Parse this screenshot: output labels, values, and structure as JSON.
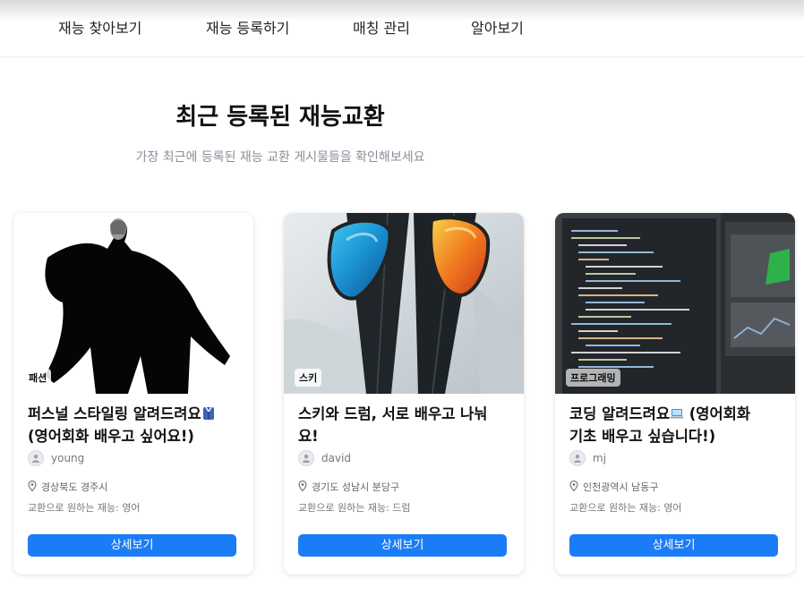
{
  "nav": {
    "items": [
      {
        "label": "재능 찾아보기"
      },
      {
        "label": "재능 등록하기"
      },
      {
        "label": "매칭 관리"
      },
      {
        "label": "알아보기"
      }
    ]
  },
  "section": {
    "title": "최근 등록된 재능교환",
    "subtitle": "가장 최근에 등록된 재능 교환 게시물들을 확인해보세요"
  },
  "cards": [
    {
      "category": "패션",
      "title_line1": "퍼스널 스타일링 알려드려요",
      "title_line2": "(영어회화 배우고 싶어요!)",
      "title_emoji": "dress-emoji",
      "username": "young",
      "location": "경상북도 경주시",
      "wanted": "교환으로 원하는 재능: 영어",
      "button_label": "상세보기"
    },
    {
      "category": "스키",
      "title_line1": "스키와 드럼, 서로 배우고 나눠",
      "title_line2": "요!",
      "username": "david",
      "location": "경기도 성남시 분당구",
      "wanted": "교환으로 원하는 재능: 드럼",
      "button_label": "상세보기"
    },
    {
      "category": "프로그래밍",
      "title_line1": "코딩 알려드려요",
      "title_line1b": " (영어회화",
      "title_line2": "기초 배우고 싶습니다!)",
      "title_emoji": "laptop-emoji",
      "username": "mj",
      "location": "인천광역시 남동구",
      "wanted": "교환으로 원하는 재능: 영어",
      "button_label": "상세보기"
    }
  ],
  "colors": {
    "primary_button": "#1a7cf7",
    "subtitle_text": "#8a8f99"
  }
}
